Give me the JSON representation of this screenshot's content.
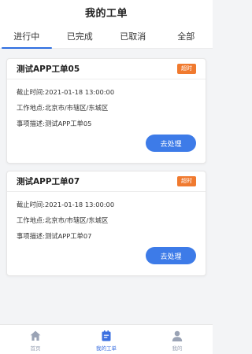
{
  "header": {
    "title": "我的工单"
  },
  "tabs": [
    {
      "label": "进行中"
    },
    {
      "label": "已完成"
    },
    {
      "label": "已取消"
    },
    {
      "label": "全部"
    }
  ],
  "orders": [
    {
      "title": "测试APP工单05",
      "badge": "超时",
      "deadline": "截止时间:2021-01-18 13:00:00",
      "location": "工作地点:北京市/市辖区/东城区",
      "description": "事项描述:测试APP工单05",
      "action_label": "去处理"
    },
    {
      "title": "测试APP工单07",
      "badge": "超时",
      "deadline": "截止时间:2021-01-18 13:00:00",
      "location": "工作地点:北京市/市辖区/东城区",
      "description": "事项描述:测试APP工单07",
      "action_label": "去处理"
    }
  ],
  "bottom_nav": [
    {
      "label": "首页",
      "icon": "home-icon"
    },
    {
      "label": "我的工单",
      "icon": "clipboard-icon"
    },
    {
      "label": "我的",
      "icon": "user-icon"
    }
  ],
  "colors": {
    "accent": "#3d7be8",
    "badge": "#f07a2f",
    "nav_inactive": "#9aa3b5"
  }
}
